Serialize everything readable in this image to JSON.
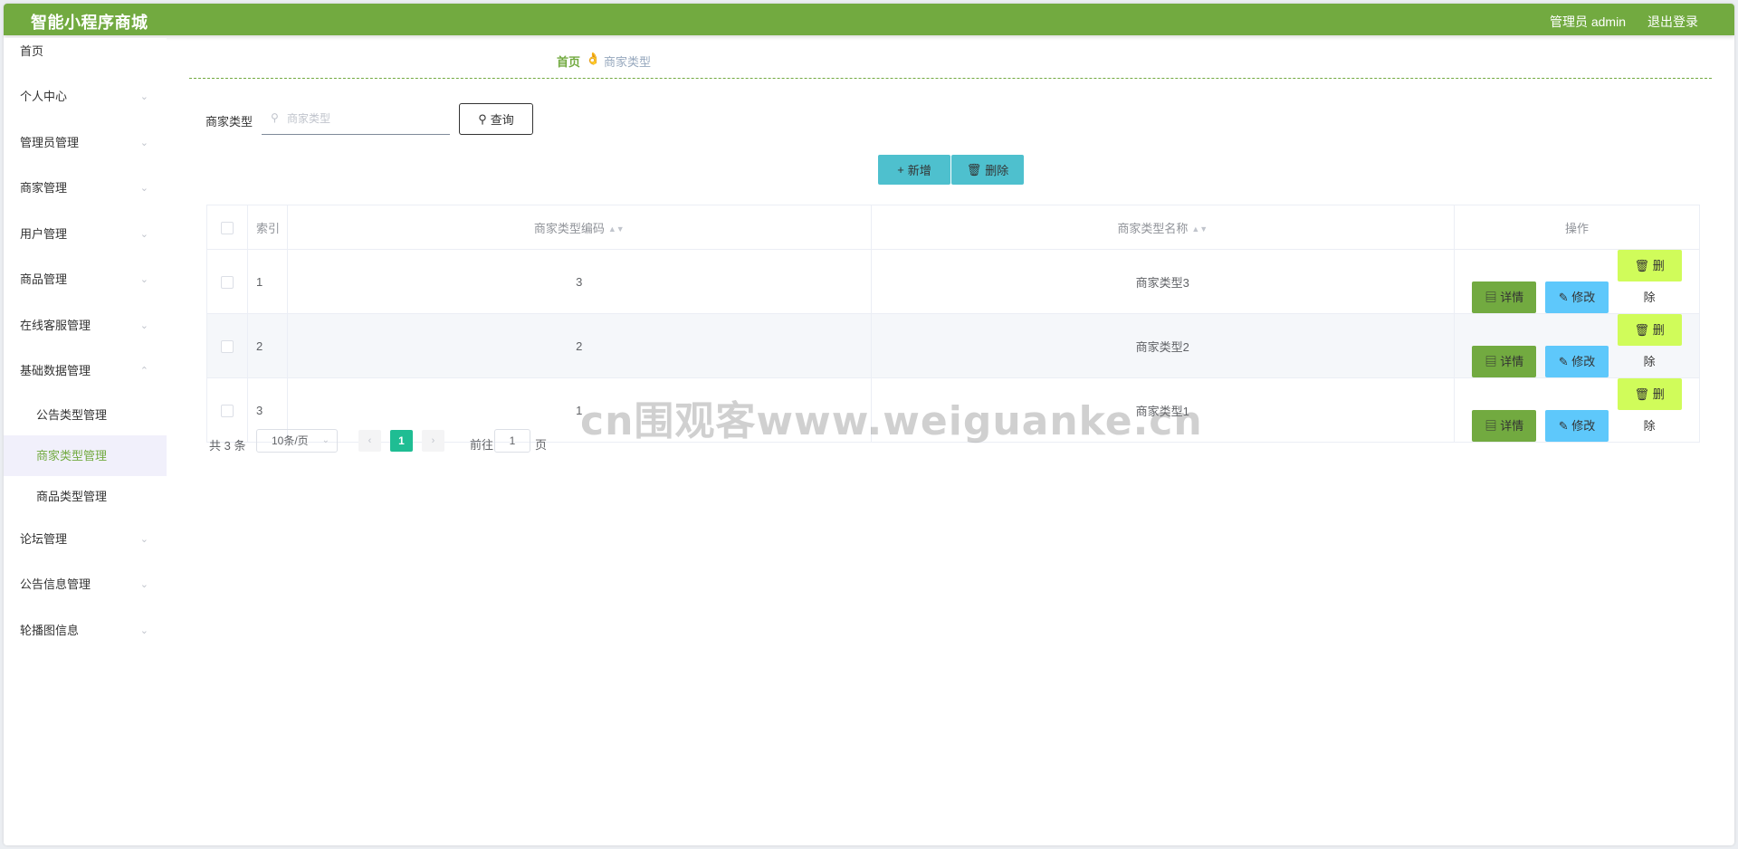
{
  "app": {
    "title": "智能小程序商城",
    "user_label": "管理员 admin",
    "logout_label": "退出登录",
    "accent_color": "#72aa40"
  },
  "sidebar": {
    "home": "首页",
    "items": [
      {
        "label": "个人中心",
        "icon": "chevron-down-icon"
      },
      {
        "label": "管理员管理",
        "icon": "chevron-down-icon"
      },
      {
        "label": "商家管理",
        "icon": "chevron-down-icon"
      },
      {
        "label": "用户管理",
        "icon": "chevron-down-icon"
      },
      {
        "label": "商品管理",
        "icon": "chevron-down-icon"
      },
      {
        "label": "在线客服管理",
        "icon": "chevron-down-icon"
      },
      {
        "label": "基础数据管理",
        "icon": "chevron-up-icon",
        "expanded": true
      }
    ],
    "subitems": [
      {
        "label": "公告类型管理"
      },
      {
        "label": "商家类型管理",
        "active": true
      },
      {
        "label": "商品类型管理"
      }
    ],
    "items_after": [
      {
        "label": "论坛管理"
      },
      {
        "label": "公告信息管理"
      },
      {
        "label": "轮播图信息"
      }
    ]
  },
  "breadcrumb": {
    "home": "首页",
    "separator_icon": "hand-icon",
    "current": "商家类型"
  },
  "search": {
    "label": "商家类型",
    "placeholder": "商家类型",
    "button": "查询"
  },
  "toolbar": {
    "add_label": "新增",
    "delete_label": "删除"
  },
  "table": {
    "headers": {
      "index": "索引",
      "code": "商家类型编码",
      "name": "商家类型名称",
      "actions": "操作"
    },
    "rows": [
      {
        "index": "1",
        "code": "3",
        "name": "商家类型3"
      },
      {
        "index": "2",
        "code": "2",
        "name": "商家类型2"
      },
      {
        "index": "3",
        "code": "1",
        "name": "商家类型1"
      }
    ],
    "action_labels": {
      "detail": "详情",
      "edit": "修改",
      "delete": "删除"
    }
  },
  "pagination": {
    "total": "共 3 条",
    "page_size": "10条/页",
    "current_page": "1",
    "goto_prefix": "前往",
    "goto_value": "1",
    "goto_suffix": "页"
  },
  "watermark": "cn围观客www.weiguanke.cn"
}
